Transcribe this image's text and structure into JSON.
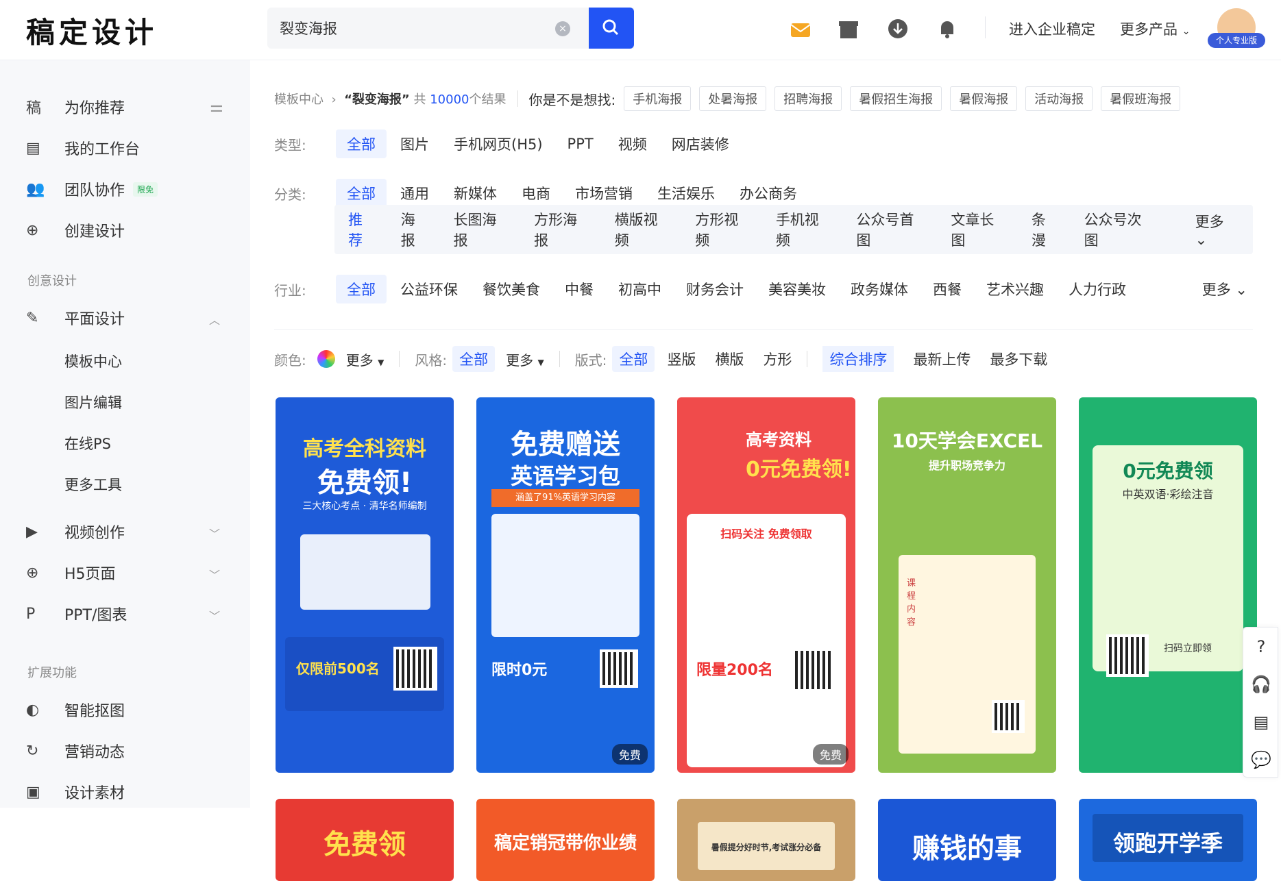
{
  "app": {
    "logo": "稿定设计"
  },
  "search": {
    "value": "裂变海报",
    "clear": "×",
    "button_icon": "search-icon"
  },
  "topbar": {
    "enterprise": "进入企业稿定",
    "more_products": "更多产品",
    "vip_badge": "个人专业版"
  },
  "sidebar": {
    "items": [
      {
        "icon": "稿",
        "label": "为你推荐"
      },
      {
        "icon": "▤",
        "label": "我的工作台"
      },
      {
        "icon": "👥",
        "label": "团队协作",
        "tag": "限免"
      },
      {
        "icon": "⊕",
        "label": "创建设计"
      }
    ],
    "group1": "创意设计",
    "design": {
      "icon": "✎",
      "label": "平面设计",
      "subs": [
        "模板中心",
        "图片编辑",
        "在线PS",
        "更多工具"
      ]
    },
    "items2": [
      {
        "icon": "▶",
        "label": "视频创作"
      },
      {
        "icon": "⊕",
        "label": "H5页面"
      },
      {
        "icon": "P",
        "label": "PPT/图表"
      }
    ],
    "group2": "扩展功能",
    "items3": [
      {
        "icon": "◐",
        "label": "智能抠图"
      },
      {
        "icon": "↻",
        "label": "营销动态"
      },
      {
        "icon": "▣",
        "label": "设计素材"
      }
    ]
  },
  "breadcrumb": {
    "root": "模板中心",
    "query": "“裂变海报”",
    "total_prefix": "共",
    "count": "10000",
    "suffix": "个结果",
    "suggest_label": "你是不是想找:",
    "suggestions": [
      "手机海报",
      "处暑海报",
      "招聘海报",
      "暑假招生海报",
      "暑假海报",
      "活动海报",
      "暑假班海报"
    ]
  },
  "filters": {
    "type": {
      "label": "类型:",
      "options": [
        "全部",
        "图片",
        "手机网页(H5)",
        "PPT",
        "视频",
        "网店装修"
      ]
    },
    "category": {
      "label": "分类:",
      "options": [
        "全部",
        "通用",
        "新媒体",
        "电商",
        "市场营销",
        "生活娱乐",
        "办公商务"
      ]
    },
    "subcategory": {
      "options": [
        "推荐",
        "海报",
        "长图海报",
        "方形海报",
        "横版视频",
        "方形视频",
        "手机视频",
        "公众号首图",
        "文章长图",
        "条漫",
        "公众号次图"
      ],
      "more": "更多"
    },
    "industry": {
      "label": "行业:",
      "options": [
        "全部",
        "公益环保",
        "餐饮美食",
        "中餐",
        "初高中",
        "财务会计",
        "美容美妆",
        "政务媒体",
        "西餐",
        "艺术兴趣",
        "人力行政"
      ],
      "more": "更多"
    }
  },
  "sortbar": {
    "color_label": "颜色:",
    "color_more": "更多",
    "style_label": "风格:",
    "style_all": "全部",
    "style_more": "更多",
    "layout_label": "版式:",
    "layout_options": [
      "全部",
      "竖版",
      "横版",
      "方形"
    ],
    "sort_options": [
      "综合排序",
      "最新上传",
      "最多下载"
    ]
  },
  "cards": [
    {
      "title": "高考全科资料",
      "title2": "免费领!",
      "desc": "三大核心考点 · 清华名师编制",
      "footer": "仅限前500名",
      "bg": "#1e5bd8"
    },
    {
      "title": "免费赠送",
      "title2": "英语学习包",
      "desc": "涵盖了91%英语学习内容",
      "footer": "限时0元",
      "badge": "免费",
      "bg": "#1b67e0"
    },
    {
      "title": "高考资料",
      "title2": "0元免费领!",
      "desc": "扫码关注 免费领取",
      "footer": "限量200名",
      "badge": "免费",
      "bg": "#f04b4b"
    },
    {
      "title": "10天学会EXCEL",
      "title2": "提升职场竞争力",
      "desc": "课程内容",
      "footer": "",
      "bg": "#8cc04e"
    },
    {
      "title": "0元免费领",
      "title2": "中英双语·彩绘注音",
      "desc": "扫码立即领",
      "footer": "",
      "bg": "#20b36f"
    },
    {
      "title": "免费领",
      "bg": "#e73a33"
    },
    {
      "title": "稿定销冠带你业绩",
      "bg": "#f25a28"
    },
    {
      "title": "暑假提分好时节,考试涨分必备",
      "bg": "#c9a06a"
    },
    {
      "title": "赚钱的事",
      "bg": "#1b57d6"
    },
    {
      "title": "领跑开学季",
      "bg": "#1d69de"
    }
  ],
  "rightbar": [
    "?",
    "🎧",
    "▤",
    "💬"
  ]
}
